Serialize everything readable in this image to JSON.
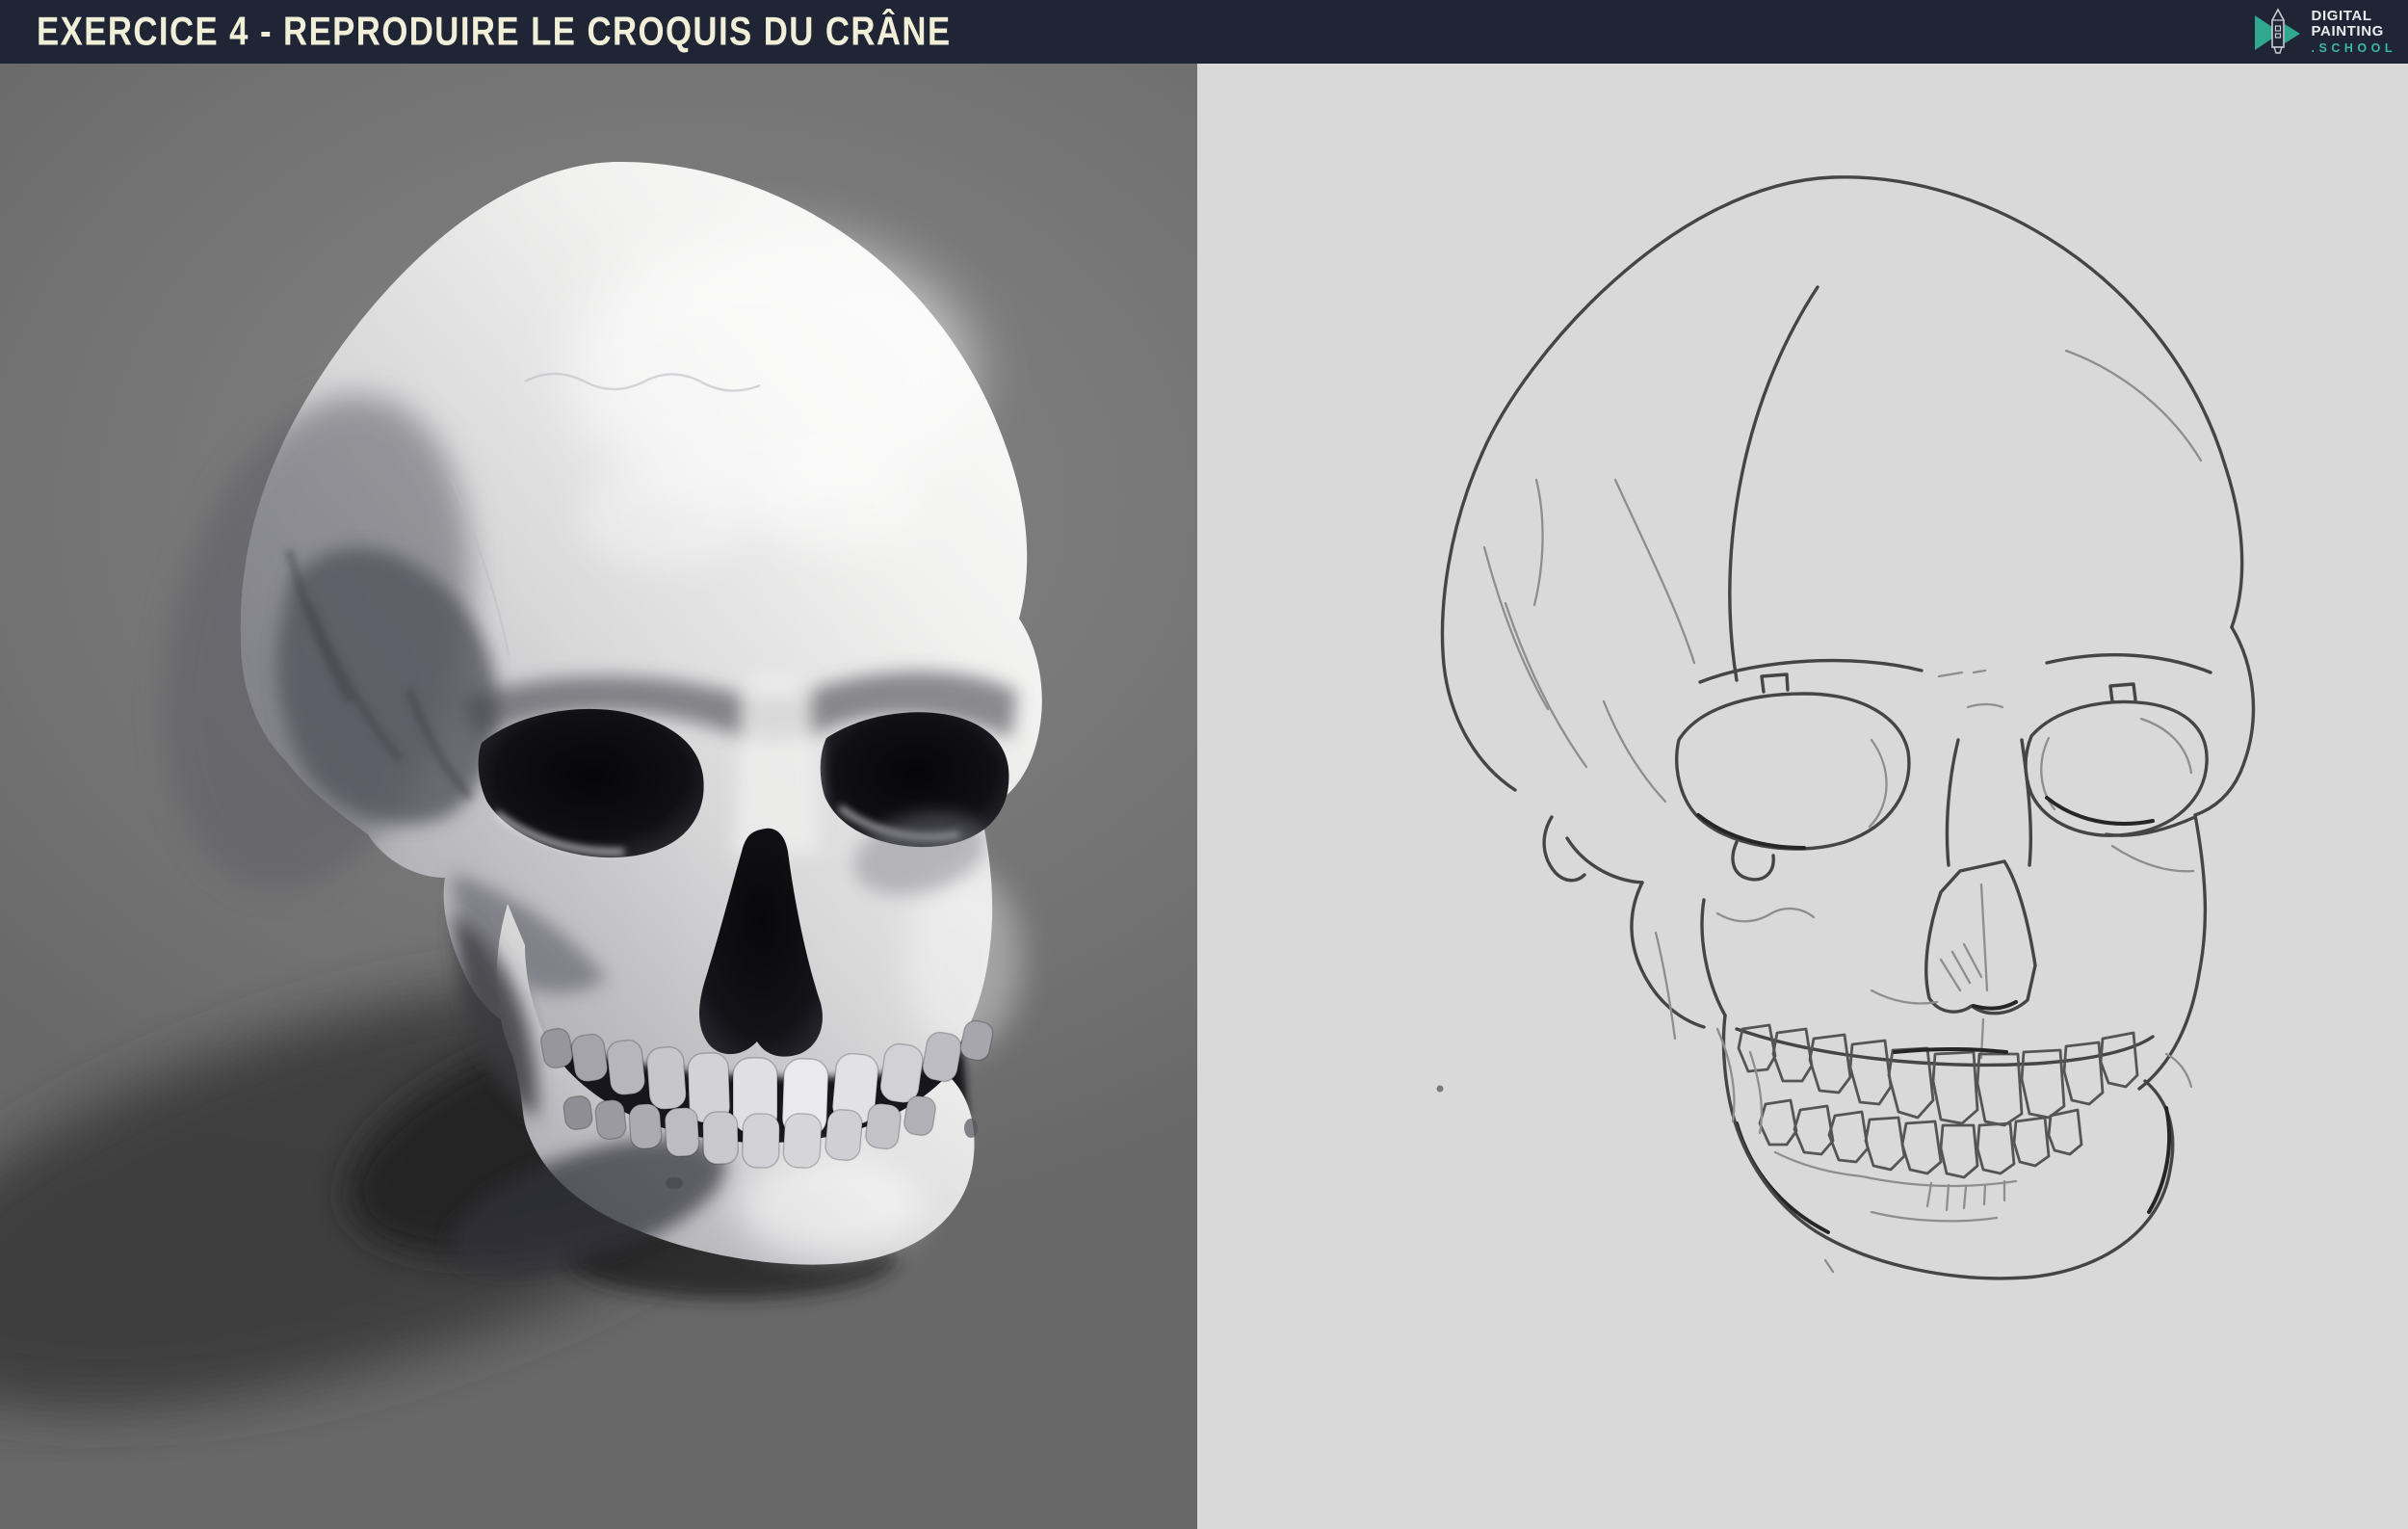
{
  "header": {
    "title": "EXERCICE 4 - REPRODUIRE LE CROQUIS DU CRÂNE",
    "colors": {
      "background": "#1f2535",
      "title_text": "#f2efd9"
    }
  },
  "logo": {
    "line1": "DIGITAL",
    "line2": "PAINTING",
    "line3": ".SCHOOL",
    "colors": {
      "accent_teal": "#31af95",
      "text": "#e8ecef"
    }
  },
  "panels": {
    "reference_render": {
      "background": "#767676",
      "subject_color": "#e9e9ea",
      "shadow_color": "#2a2a2a"
    },
    "line_sketch": {
      "background": "#d9d9d9",
      "line_color": "#454545"
    }
  }
}
